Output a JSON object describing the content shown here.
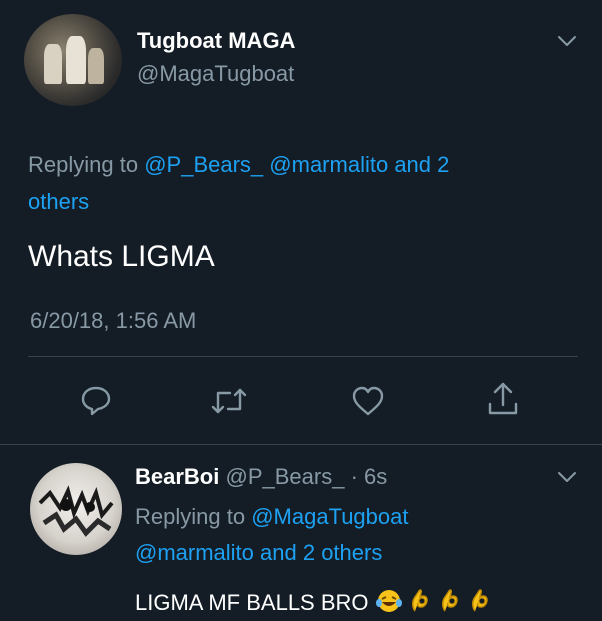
{
  "tweet": {
    "author_name": "Tugboat MAGA",
    "author_handle": "@MagaTugboat",
    "replying_to_prefix": "Replying to",
    "replying_to_users": [
      "@P_Bears_",
      "@marmalito"
    ],
    "replying_to_and": "and 2",
    "replying_to_others": "others",
    "text": "Whats LIGMA",
    "timestamp": "6/20/18, 1:56 AM"
  },
  "actions": [
    {
      "icon": "reply-icon"
    },
    {
      "icon": "retweet-icon"
    },
    {
      "icon": "like-icon"
    },
    {
      "icon": "share-icon"
    }
  ],
  "reply": {
    "author_name": "BearBoi",
    "author_handle": "@P_Bears_",
    "time": "· 6s",
    "replying_to_prefix": "Replying to",
    "replying_to_user": "@MagaTugboat",
    "replying_to_user2": "@marmalito",
    "replying_to_rest": "and 2 others",
    "text": "LIGMA MF BALLS BRO"
  },
  "colors": {
    "background": "#141d26",
    "link": "#1da1f2",
    "muted": "#8899a6",
    "divider": "#38444d"
  }
}
